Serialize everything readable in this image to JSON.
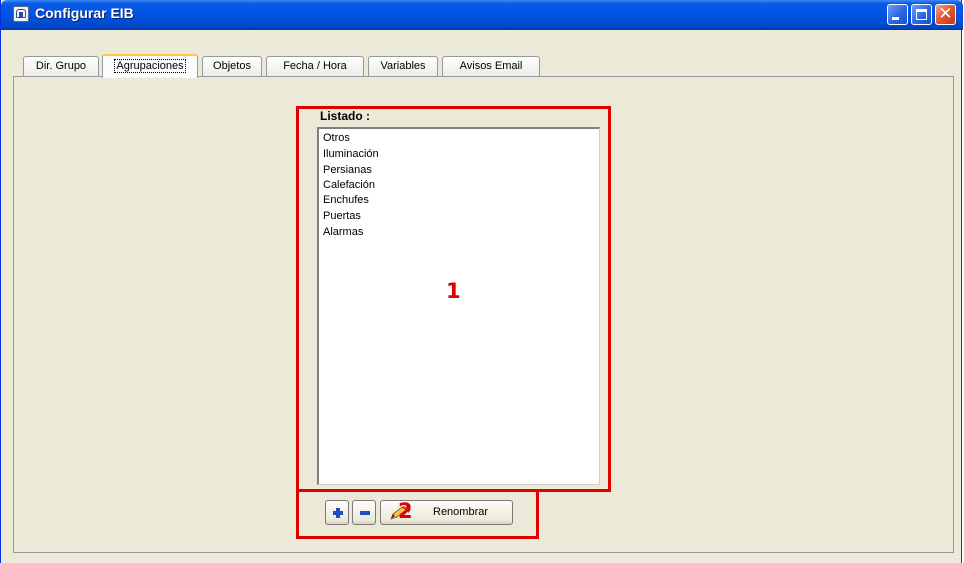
{
  "window": {
    "title": "Configurar EIB",
    "controls": [
      "minimize-icon",
      "maximize-icon",
      "close-icon"
    ],
    "close_glyph": "✕"
  },
  "tabs": [
    {
      "label": "Dir. Grupo",
      "active": false
    },
    {
      "label": "Agrupaciones",
      "active": true
    },
    {
      "label": "Objetos",
      "active": false
    },
    {
      "label": "Fecha / Hora",
      "active": false
    },
    {
      "label": "Variables",
      "active": false
    },
    {
      "label": "Avisos Email",
      "active": false
    }
  ],
  "listado": {
    "label": "Listado :",
    "items": [
      "Otros",
      "Iluminación",
      "Persianas",
      "Calefación",
      "Enchufes",
      "Puertas",
      "Alarmas"
    ]
  },
  "buttons": {
    "add_icon": "plus-icon",
    "remove_icon": "minus-icon",
    "rename_icon": "rename-pencil-icon",
    "rename_label": "Renombrar"
  },
  "annotations": {
    "marker_1": "1",
    "marker_2": "2",
    "color": "#e00000"
  },
  "colors": {
    "titlebar": "#0054e3",
    "window_bg": "#ece9d8",
    "active_tab_accent": "#ffc83c"
  }
}
